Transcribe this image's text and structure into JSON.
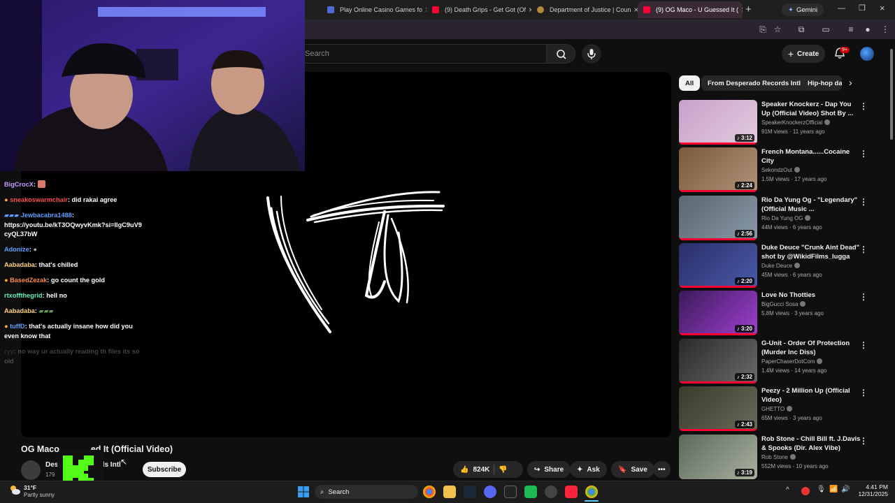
{
  "browser": {
    "tabs": [
      {
        "label": "Play Online Casino Games fo",
        "color": "#4a6cd4"
      },
      {
        "label": "(9) Death Grips - Get Got (Of",
        "color": "#ff0033"
      },
      {
        "label": "Department of Justice | Coun",
        "color": "#b08a3a"
      },
      {
        "label": "(9) OG Maco - U Guessed It (",
        "color": "#ff0033",
        "active": true
      }
    ],
    "gemini_label": "Gemini"
  },
  "youtube": {
    "search_placeholder": "Search",
    "create_label": "Create",
    "notif_count": "9+",
    "video_title_visible_left": "OG Maco",
    "video_title_visible_right": "ed It (Official Video)",
    "channel_name_left": "Des",
    "channel_name_right": "ds Intl",
    "channel_subs": "179",
    "subscribe_label": "Subscribe",
    "likes": "824K",
    "share_label": "Share",
    "ask_label": "Ask",
    "save_label": "Save",
    "chips": [
      "All",
      "From Desperado Records Intl",
      "Hip-hop da"
    ]
  },
  "recommendations": [
    {
      "title": "Speaker Knockerz - Dap You Up (Official Video) Shot By ...",
      "channel": "SpeakerKnockerzOfficial",
      "meta": "91M views · 11 years ago",
      "duration": "3:12",
      "progress": 1.0
    },
    {
      "title": "French Montana......Cocaine City",
      "channel": "SekondzOut",
      "meta": "1.5M views · 17 years ago",
      "duration": "2:24",
      "progress": 1.0
    },
    {
      "title": "Rio Da Yung Og - \"Legendary\" (Official Music ...",
      "channel": "Rio Da Yung OG",
      "meta": "44M views · 6 years ago",
      "duration": "2:56",
      "progress": 1.0
    },
    {
      "title": "Duke Deuce \"Crunk Aint Dead\" shot by @WikidFilms_lugga",
      "channel": "Duke Deuce",
      "meta": "45M views · 6 years ago",
      "duration": "2:20",
      "progress": 1.0
    },
    {
      "title": "Love No Thotties",
      "channel": "BigGucci Sosa",
      "meta": "5.8M views · 3 years ago",
      "duration": "3:20",
      "progress": 1.0
    },
    {
      "title": "G-Unit - Order Of Protection (Murder Inc Diss)",
      "channel": "PaperChaserDotCom",
      "meta": "1.4M views · 14 years ago",
      "duration": "2:32",
      "progress": 1.0
    },
    {
      "title": "Peezy - 2 Million Up (Official Video)",
      "channel": "GHETTO",
      "meta": "65M views · 3 years ago",
      "duration": "2:43",
      "progress": 1.0
    },
    {
      "title": "Rob Stone - Chill Bill ft. J.Davis & Spooks (Dir. Alex Vibe)",
      "channel": "Rob Stone",
      "meta": "552M views · 10 years ago",
      "duration": "3:19",
      "progress": 0.0
    }
  ],
  "chat": [
    {
      "user": "BigCrocX",
      "color": "#c59bff",
      "msg": ""
    },
    {
      "user": "sneakoswarmchair",
      "color": "#ff4a4a",
      "msg": "did rakai agree"
    },
    {
      "user": "Jewbacabra1488",
      "color": "#5aa0ff",
      "msg": "https://youtu.be/kT3OQwyvKmk?si=IlgC9uV9cyQL37bW"
    },
    {
      "user": "Adonize",
      "color": "#5aa0ff",
      "msg": ""
    },
    {
      "user": "Aabadaba",
      "color": "#ffd27a",
      "msg": "that's chilled"
    },
    {
      "user": "BasedZezak",
      "color": "#ff8a3d",
      "msg": "go count the gold"
    },
    {
      "user": "rtxoffthegrid",
      "color": "#5ff0c0",
      "msg": "hell no"
    },
    {
      "user": "Aabadaba",
      "color": "#ffd27a",
      "msg": ""
    },
    {
      "user": "tuffD",
      "color": "#5aa0ff",
      "msg": "that's actually insane how did you even know that"
    },
    {
      "user": "ryy",
      "color": "#777777",
      "msg": "no way ur actually reading th files its so old"
    }
  ],
  "weather": {
    "temp": "31°F",
    "desc": "Partly sunny"
  },
  "taskbar": {
    "search_label": "Search",
    "time": "4:41 PM",
    "date": "12/31/2025"
  },
  "colors": {
    "accent_red": "#ff0033",
    "bg": "#0f0f0f"
  }
}
